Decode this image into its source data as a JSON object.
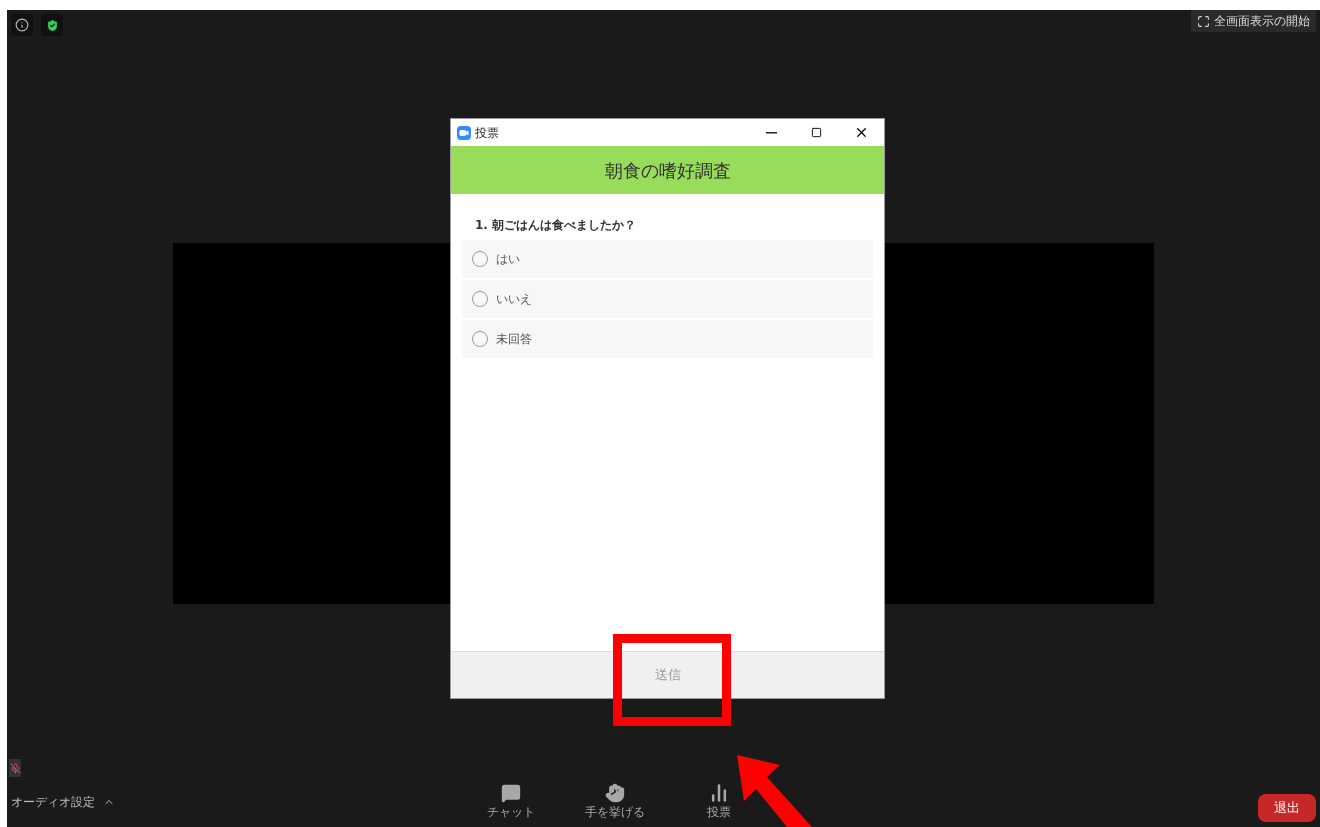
{
  "top_bar": {
    "fullscreen_button": "全画面表示の開始"
  },
  "poll_window": {
    "title": "投票",
    "header": "朝食の嗜好調査",
    "question": "1. 朝ごはんは食べましたか？",
    "options": [
      {
        "label": "はい",
        "selected": false
      },
      {
        "label": "いいえ",
        "selected": false
      },
      {
        "label": "未回答",
        "selected": false
      }
    ],
    "submit": {
      "label": "送信",
      "disabled": true
    }
  },
  "bottom_bar": {
    "audio_settings": "オーディオ設定",
    "mic_muted": true,
    "tools": [
      {
        "kind": "chat",
        "label": "チャット"
      },
      {
        "kind": "hand",
        "label": "手を挙げる"
      },
      {
        "kind": "poll",
        "label": "投票"
      }
    ],
    "leave_button": "退出"
  }
}
